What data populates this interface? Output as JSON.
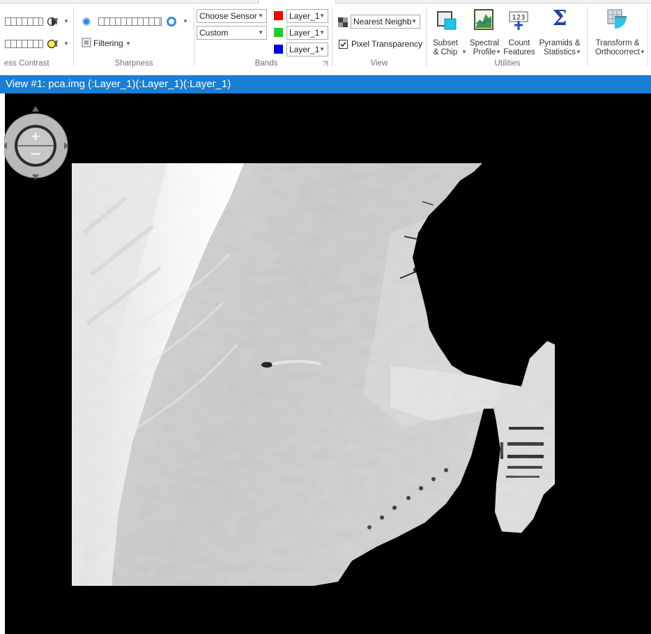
{
  "ribbon": {
    "groups": {
      "contrast": "ess Contrast",
      "sharpness": "Sharpness",
      "bands": "Bands",
      "view": "View",
      "utilities": "Utilities"
    },
    "sharpness": {
      "filtering_label": "Filtering"
    },
    "bands": {
      "sensor_select": "Choose Sensor",
      "preset_select": "Custom",
      "red_layer": "Layer_1",
      "green_layer": "Layer_1",
      "blue_layer": "Layer_1",
      "red_color": "#ff0000",
      "green_color": "#22cc22",
      "blue_color": "#0000ee"
    },
    "view": {
      "resampling": "Nearest Neighb",
      "pixel_transparency_label": "Pixel Transparency",
      "pixel_transparency_checked": true
    },
    "utilities": {
      "subset_l1": "Subset",
      "subset_l2": "& Chip",
      "spectral_l1": "Spectral",
      "spectral_l2": "Profile",
      "count_l1": "Count",
      "count_l2": "Features",
      "count_icon_text": "123",
      "pyramids_l1": "Pyramids &",
      "pyramids_l2": "Statistics",
      "sigma": "Σ",
      "transform_l1": "Transform &",
      "transform_l2": "Orthocorrect"
    }
  },
  "viewer": {
    "title": "View #1: pca.img (:Layer_1)(:Layer_1)(:Layer_1)",
    "background": "#000000",
    "accent": "#1a7fd4"
  },
  "icons": {
    "contrast_icon": "contrast-icon",
    "brightness_icon": "brightness-icon",
    "sharpness_icon": "sharpness-icon",
    "filter_icon": "filter-icon",
    "zoom_in": "+",
    "zoom_out": "−"
  }
}
